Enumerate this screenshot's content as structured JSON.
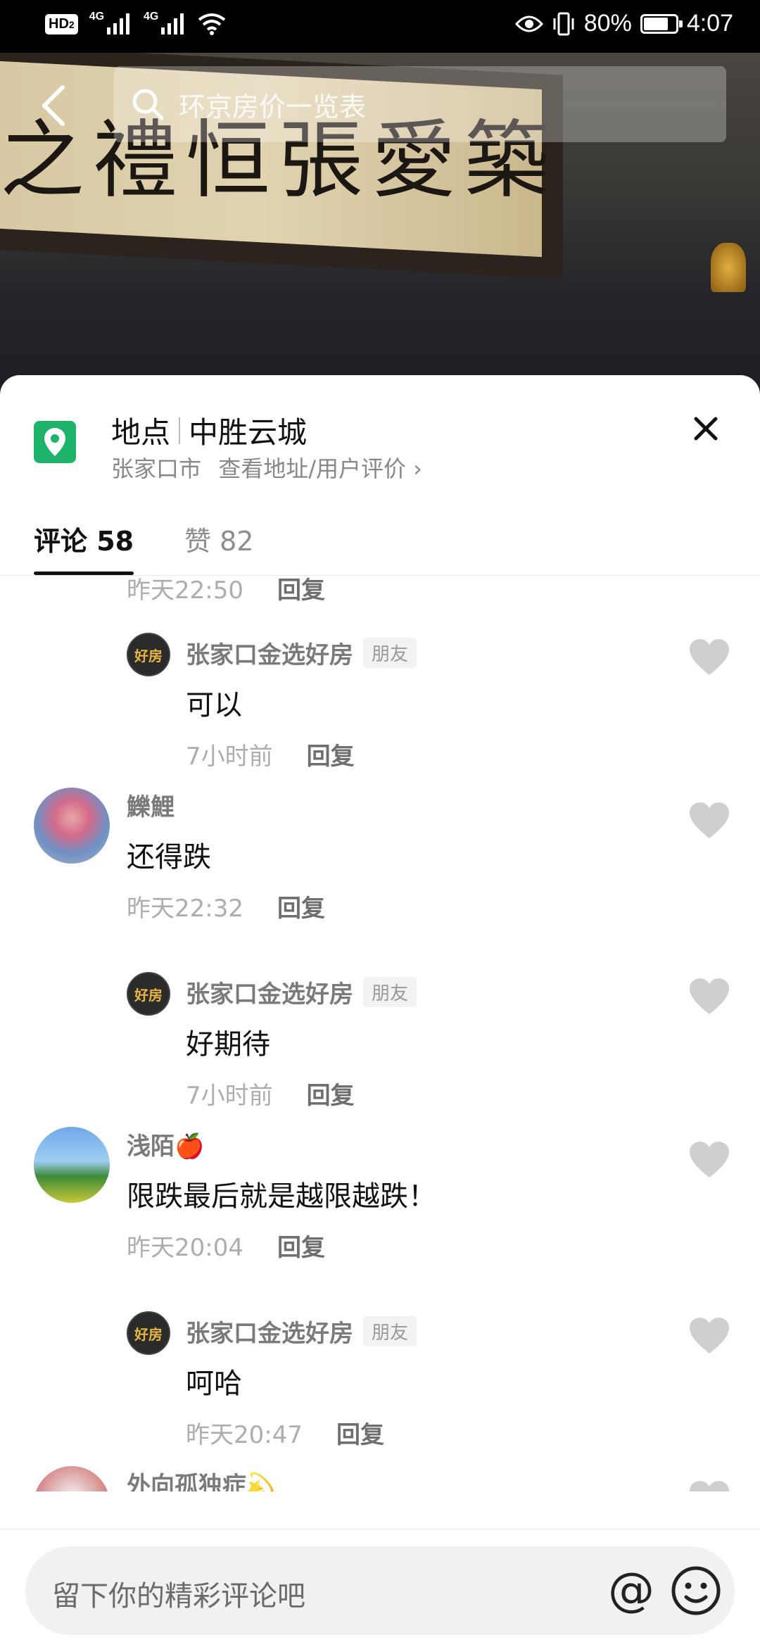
{
  "status_bar": {
    "hd": "HD",
    "hd_sub": "2",
    "net1": "4G",
    "net2": "4G",
    "battery_pct": "80%",
    "time": "4:07",
    "battery_level": 0.8
  },
  "video": {
    "calligraphy": "之禮恒張愛築"
  },
  "search": {
    "placeholder": "环京房价一览表"
  },
  "location": {
    "label": "地点",
    "name": "中胜云城",
    "city": "张家口市",
    "link": "查看地址/用户评价",
    "link_chevron": "›"
  },
  "tabs": {
    "comments": "评论 58",
    "likes": "赞 82"
  },
  "comments": [
    {
      "time": "昨天22:50",
      "reply": "回复"
    },
    {
      "name": "张家口金选好房",
      "badge": "朋友",
      "text": "可以",
      "time": "7小时前",
      "reply": "回复",
      "avatar": "好房"
    },
    {
      "name": "鱳鯉",
      "text": "还得跌",
      "time": "昨天22:32",
      "reply": "回复"
    },
    {
      "name": "张家口金选好房",
      "badge": "朋友",
      "text": "好期待",
      "time": "7小时前",
      "reply": "回复",
      "avatar": "好房"
    },
    {
      "name": "浅陌🍎",
      "text": "限跌最后就是越限越跌！",
      "time": "昨天20:04",
      "reply": "回复"
    },
    {
      "name": "张家口金选好房",
      "badge": "朋友",
      "text": "呵哈",
      "time": "昨天20:47",
      "reply": "回复",
      "avatar": "好房"
    },
    {
      "name": "外向孤独症💫"
    }
  ],
  "input": {
    "placeholder": "留下你的精彩评论吧",
    "at": "@"
  },
  "colors": {
    "accent_green": "#1db369",
    "text_primary": "#111111",
    "text_secondary": "#888888"
  }
}
